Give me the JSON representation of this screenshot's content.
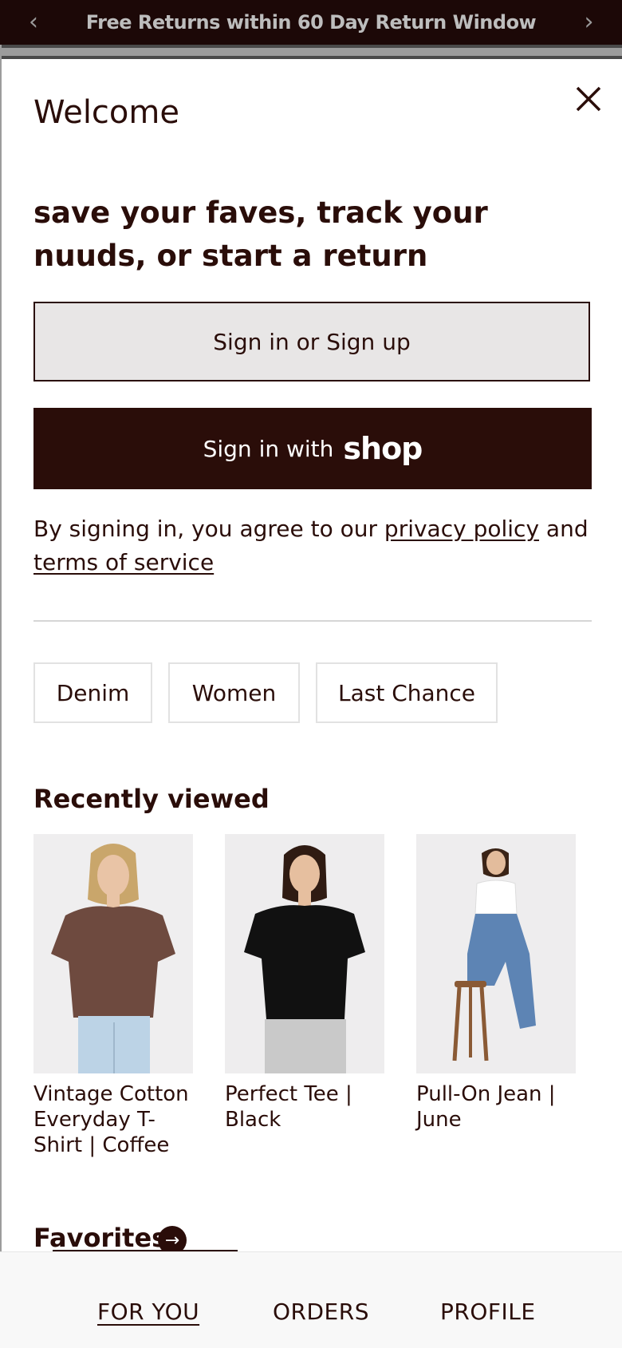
{
  "announcement": {
    "text": "Free Returns within 60 Day Return Window",
    "prev_icon": "chevron-left-icon",
    "next_icon": "chevron-right-icon"
  },
  "modal": {
    "title": "Welcome",
    "close_icon": "close-icon",
    "headline": "save your faves, track your nuuds, or start a return",
    "sign_in_button": "Sign in or Sign up",
    "shop_button_prefix": "Sign in with",
    "shop_button_logo": "shop",
    "legal": {
      "prefix": "By signing in, you agree to our ",
      "privacy_link": "privacy policy",
      "middle": " and",
      "terms_link": "terms of service"
    }
  },
  "categories": [
    "Denim",
    "Women",
    "Last Chance"
  ],
  "recently_viewed": {
    "title": "Recently viewed",
    "items": [
      {
        "title": "Vintage Cotton Everyday T-Shirt | Coffee"
      },
      {
        "title": "Perfect Tee | Black"
      },
      {
        "title": "Pull-On Jean | June"
      }
    ]
  },
  "favorites": {
    "title": "Favorites",
    "arrow_icon": "arrow-right-icon"
  },
  "bottom_nav": {
    "items": [
      {
        "label": "FOR YOU",
        "active": true
      },
      {
        "label": "ORDERS",
        "active": false
      },
      {
        "label": "PROFILE",
        "active": false
      }
    ]
  },
  "colors": {
    "brand_dark": "#2a0d09",
    "announcement_bg": "#1c0807",
    "secondary_button_bg": "#e8e6e6"
  }
}
